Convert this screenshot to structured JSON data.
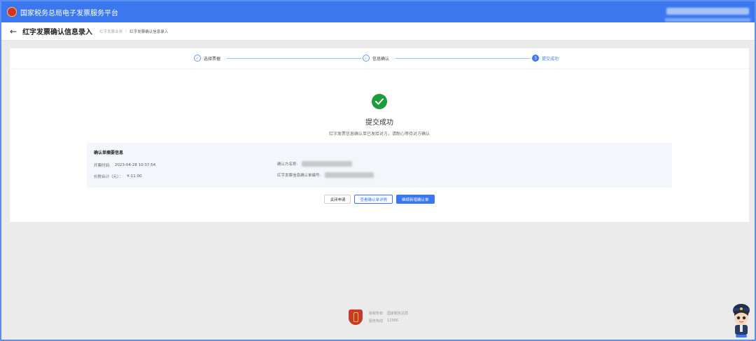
{
  "header": {
    "title": "国家税务总局电子发票服务平台",
    "logo_icon": "tax-emblem-icon"
  },
  "subheader": {
    "back_icon": "arrow-left-icon",
    "title": "红字发票确认信息录入",
    "breadcrumb": [
      "红字发票业务",
      "红字发票确认信息录入"
    ]
  },
  "steps": [
    {
      "number": "1",
      "label": "选择票据",
      "state": "done"
    },
    {
      "number": "2",
      "label": "信息确认",
      "state": "done"
    },
    {
      "number": "3",
      "label": "提交成功",
      "state": "active"
    }
  ],
  "result": {
    "icon": "success-check-icon",
    "title": "提交成功",
    "description": "红字发票信息确认单已发给对方，请耐心等待对方确认"
  },
  "info": {
    "heading": "确认单摘要信息",
    "issue_time_label": "开票时间:",
    "issue_time_value": "2023-04-28 10:37:54",
    "amount_label": "价税合计（元）：",
    "amount_value": "¥-11.00",
    "confirmer_label": "确认方名称:",
    "confirm_no_label": "红字发票信息确认单编号:"
  },
  "buttons": {
    "close": "关闭申请",
    "view_detail": "查看确认单详情",
    "continue_new": "继续新增确认单"
  },
  "footer": {
    "emblem_icon": "tax-shield-icon",
    "row1_label": "版权所有",
    "row1_value": "国家税务总局",
    "row2_label": "服务热线",
    "row2_value": "12366"
  },
  "colors": {
    "brand_blue": "#3b78f0",
    "success_green": "#1e9b3d",
    "page_bg": "#ebebeb"
  }
}
